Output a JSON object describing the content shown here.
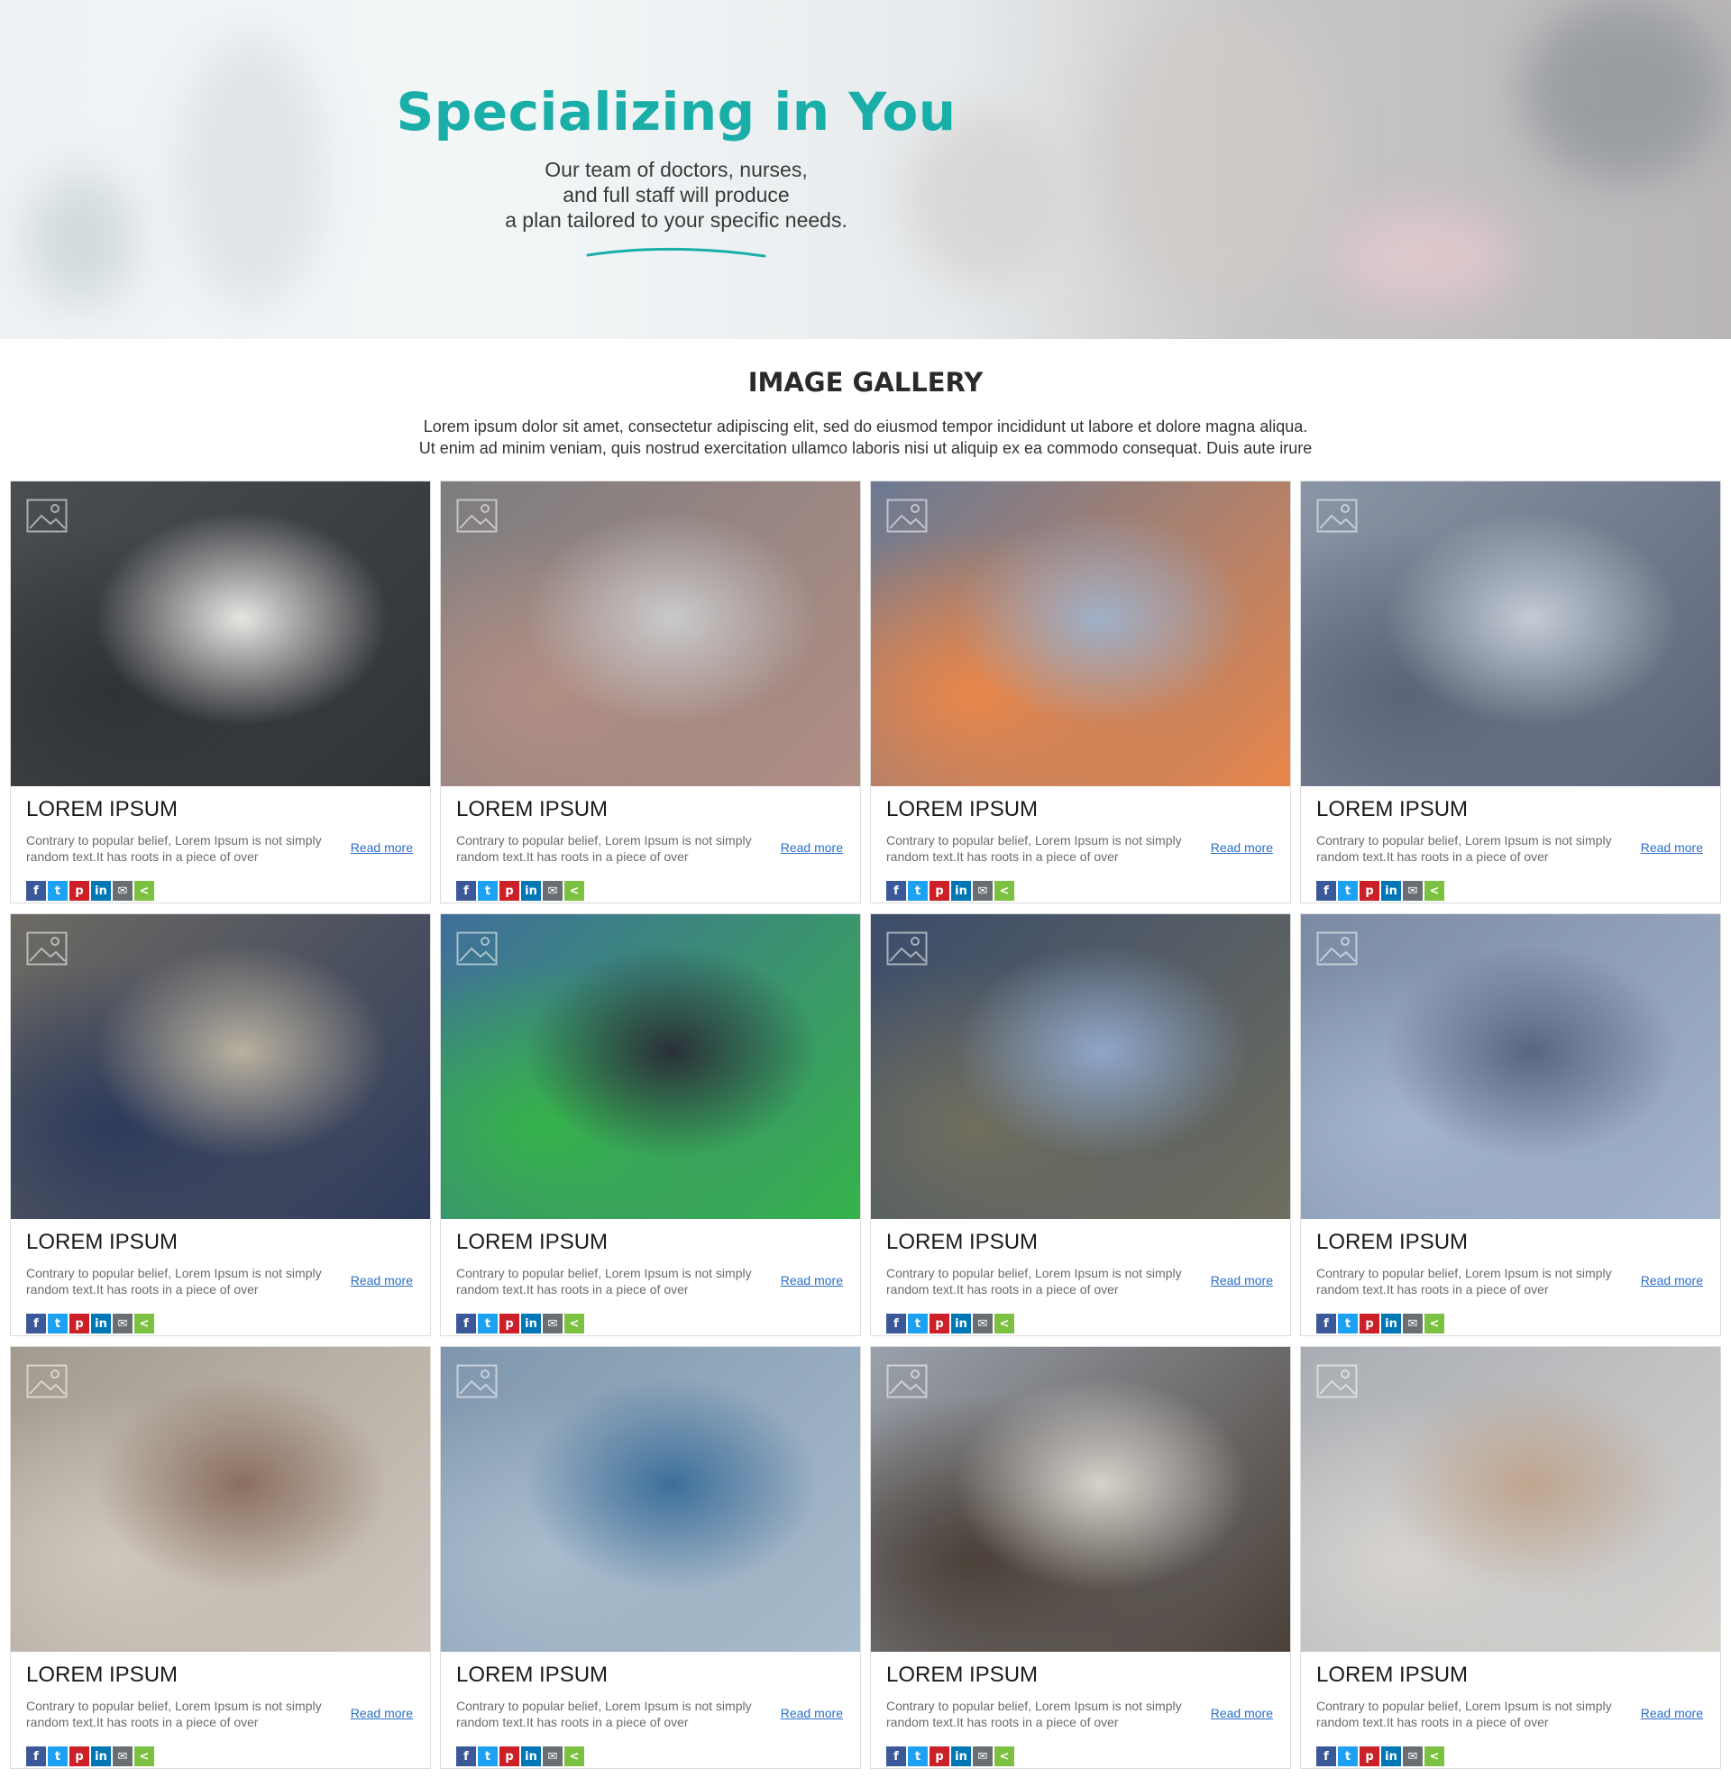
{
  "hero": {
    "title": "Specializing in You",
    "subtitle_lines": [
      "Our team of doctors, nurses,",
      "and full staff will produce",
      "a plan tailored to your specific needs."
    ],
    "accent_color": "#1aaea8"
  },
  "gallery": {
    "heading": "IMAGE GALLERY",
    "description": "Lorem ipsum dolor sit amet, consectetur adipiscing elit, sed do eiusmod tempor incididunt ut labore et dolore magna aliqua. Ut enim ad minim veniam, quis nostrud exercitation ullamco laboris nisi ut aliquip ex ea commodo consequat. Duis aute irure",
    "cards": [
      {
        "title": "LOREM IPSUM",
        "excerpt": "Contrary to popular belief, Lorem Ipsum is not simply random text.It has roots in a piece of over",
        "read_more": "Read more",
        "image": "doctor-portrait",
        "palette": [
          "#4a4d52",
          "#2f3236",
          "#e8e6e3"
        ]
      },
      {
        "title": "LOREM IPSUM",
        "excerpt": "Contrary to popular belief, Lorem Ipsum is not simply random text.It has roots in a piece of over",
        "read_more": "Read more",
        "image": "hands-tablet",
        "palette": [
          "#7d7d7f",
          "#b38e84",
          "#c9c9cb"
        ]
      },
      {
        "title": "LOREM IPSUM",
        "excerpt": "Contrary to popular belief, Lorem Ipsum is not simply random text.It has roots in a piece of over",
        "read_more": "Read more",
        "image": "microscope",
        "palette": [
          "#6c7a93",
          "#e8864a",
          "#9fb0c8"
        ]
      },
      {
        "title": "LOREM IPSUM",
        "excerpt": "Contrary to popular belief, Lorem Ipsum is not simply random text.It has roots in a piece of over",
        "read_more": "Read more",
        "image": "doctor-patient",
        "palette": [
          "#8a95a6",
          "#5b6577",
          "#c3ccd6"
        ]
      },
      {
        "title": "LOREM IPSUM",
        "excerpt": "Contrary to popular belief, Lorem Ipsum is not simply random text.It has roots in a piece of over",
        "read_more": "Read more",
        "image": "bottles-glass",
        "palette": [
          "#6d6a63",
          "#2e3b5c",
          "#b9b1a0"
        ]
      },
      {
        "title": "LOREM IPSUM",
        "excerpt": "Contrary to popular belief, Lorem Ipsum is not simply random text.It has roots in a piece of over",
        "read_more": "Read more",
        "image": "pharmacy-cross-24h",
        "palette": [
          "#3f6f9a",
          "#36b24a",
          "#2a3038"
        ]
      },
      {
        "title": "LOREM IPSUM",
        "excerpt": "Contrary to popular belief, Lorem Ipsum is not simply random text.It has roots in a piece of over",
        "read_more": "Read more",
        "image": "mri-scan",
        "palette": [
          "#3c4d6b",
          "#6f6e5e",
          "#8fa6c9"
        ]
      },
      {
        "title": "LOREM IPSUM",
        "excerpt": "Contrary to popular belief, Lorem Ipsum is not simply random text.It has roots in a piece of over",
        "read_more": "Read more",
        "image": "surgery-team",
        "palette": [
          "#7a8aa3",
          "#a3b4cc",
          "#5a6680"
        ]
      },
      {
        "title": "LOREM IPSUM",
        "excerpt": "Contrary to popular belief, Lorem Ipsum is not simply random text.It has roots in a piece of over",
        "read_more": "Read more",
        "image": "doctor-consult",
        "palette": [
          "#a39a8f",
          "#cfc7bd",
          "#8b6f60"
        ]
      },
      {
        "title": "LOREM IPSUM",
        "excerpt": "Contrary to popular belief, Lorem Ipsum is not simply random text.It has roots in a piece of over",
        "read_more": "Read more",
        "image": "tablet-coffee",
        "palette": [
          "#7f97ad",
          "#a9bccd",
          "#3d6f9a"
        ]
      },
      {
        "title": "LOREM IPSUM",
        "excerpt": "Contrary to popular belief, Lorem Ipsum is not simply random text.It has roots in a piece of over",
        "read_more": "Read more",
        "image": "woman-portrait",
        "palette": [
          "#9aa1ab",
          "#4a4038",
          "#d7d2cb"
        ]
      },
      {
        "title": "LOREM IPSUM",
        "excerpt": "Contrary to popular belief, Lorem Ipsum is not simply random text.It has roots in a piece of over",
        "read_more": "Read more",
        "image": "clinic-treatment",
        "palette": [
          "#a9adb3",
          "#d6d3cf",
          "#bfa58f"
        ]
      }
    ],
    "share_icons": [
      {
        "name": "facebook-icon",
        "glyph": "f",
        "cls": "s-fb"
      },
      {
        "name": "twitter-icon",
        "glyph": "t",
        "cls": "s-tw"
      },
      {
        "name": "pinterest-icon",
        "glyph": "p",
        "cls": "s-pin"
      },
      {
        "name": "linkedin-icon",
        "glyph": "in",
        "cls": "s-in"
      },
      {
        "name": "email-icon",
        "glyph": "✉",
        "cls": "s-mail"
      },
      {
        "name": "share-icon",
        "glyph": "<",
        "cls": "s-share"
      }
    ]
  }
}
